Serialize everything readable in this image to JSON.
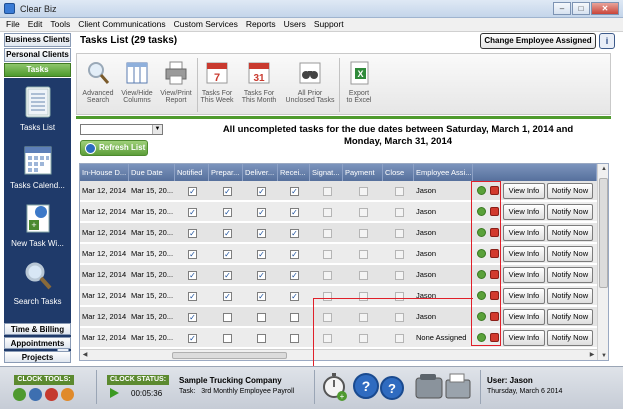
{
  "window": {
    "title": "Clear Biz"
  },
  "menu": [
    "File",
    "Edit",
    "Tools",
    "Client Communications",
    "Custom Services",
    "Reports",
    "Users",
    "Support"
  ],
  "nav": {
    "top": [
      "Business Clients",
      "Personal Clients",
      "Tasks"
    ],
    "items": [
      "Tasks List",
      "Tasks Calend...",
      "New Task Wi...",
      "Search Tasks"
    ],
    "bottom": [
      "Time & Billing",
      "Appointments",
      "Projects"
    ]
  },
  "header": {
    "title": "Tasks List (29 tasks)",
    "change_employee": "Change Employee Assigned",
    "info_icon_label": "i"
  },
  "toolbar": [
    {
      "label1": "Advanced",
      "label2": "Search",
      "icon": "magnifier-icon"
    },
    {
      "label1": "View/Hide",
      "label2": "Columns",
      "icon": "columns-icon"
    },
    {
      "label1": "View/Print",
      "label2": "Report",
      "icon": "printer-icon"
    },
    {
      "label1": "Tasks For",
      "label2": "This Week",
      "icon": "calendar-7-icon",
      "cal": "7"
    },
    {
      "label1": "Tasks For",
      "label2": "This Month",
      "icon": "calendar-31-icon",
      "cal": "31"
    },
    {
      "label1": "All Prior",
      "label2": "Unclosed Tasks",
      "icon": "binoculars-icon"
    },
    {
      "label1": "Export",
      "label2": "to Excel",
      "icon": "excel-icon"
    }
  ],
  "filter": {
    "refresh": "Refresh List",
    "period_text": "All uncompleted tasks for the due dates between Saturday, March 1, 2014 and Monday, March 31, 2014"
  },
  "grid": {
    "columns": [
      "In-House D...",
      "Due Date",
      "Notified",
      "Prepar...",
      "Deliver...",
      "Recei...",
      "Signat...",
      "Payment",
      "Close",
      "Employee Assi..."
    ],
    "view_info": "View Info",
    "notify_now": "Notify Now",
    "rows": [
      {
        "inhouse": "Mar 12, 2014",
        "due": "Mar 15, 20...",
        "checks": [
          1,
          1,
          1,
          1,
          0,
          0,
          0
        ],
        "employee": "Jason"
      },
      {
        "inhouse": "Mar 12, 2014",
        "due": "Mar 15, 20...",
        "checks": [
          1,
          1,
          1,
          1,
          0,
          0,
          0
        ],
        "employee": "Jason"
      },
      {
        "inhouse": "Mar 12, 2014",
        "due": "Mar 15, 20...",
        "checks": [
          1,
          1,
          1,
          1,
          0,
          0,
          0
        ],
        "employee": "Jason"
      },
      {
        "inhouse": "Mar 12, 2014",
        "due": "Mar 15, 20...",
        "checks": [
          1,
          1,
          1,
          1,
          0,
          0,
          0
        ],
        "employee": "Jason"
      },
      {
        "inhouse": "Mar 12, 2014",
        "due": "Mar 15, 20...",
        "checks": [
          1,
          1,
          1,
          1,
          0,
          0,
          0
        ],
        "employee": "Jason"
      },
      {
        "inhouse": "Mar 12, 2014",
        "due": "Mar 15, 20...",
        "checks": [
          1,
          1,
          1,
          1,
          0,
          0,
          0
        ],
        "employee": "Jason"
      },
      {
        "inhouse": "Mar 12, 2014",
        "due": "Mar 15, 20...",
        "checks": [
          1,
          0,
          0,
          0,
          0,
          0,
          0
        ],
        "employee": "Jason"
      },
      {
        "inhouse": "Mar 12, 2014",
        "due": "Mar 15, 20...",
        "checks": [
          1,
          0,
          0,
          0,
          0,
          0,
          0
        ],
        "employee": "None Assigned"
      }
    ]
  },
  "status": {
    "clock_tools": "CLOCK TOOLS:",
    "clock_status": "CLOCK STATUS:",
    "timer": "00:05:36",
    "company": "Sample Trucking Company",
    "task_label": "Task:",
    "task": "3rd Monthly Employee Payroll",
    "user": "User: Jason",
    "date": "Thursday, March 6 2014"
  },
  "colors": {
    "accent_green": "#4e9a2d",
    "nav_blue": "#1f3a6a",
    "annotation_red": "#e0202a"
  }
}
